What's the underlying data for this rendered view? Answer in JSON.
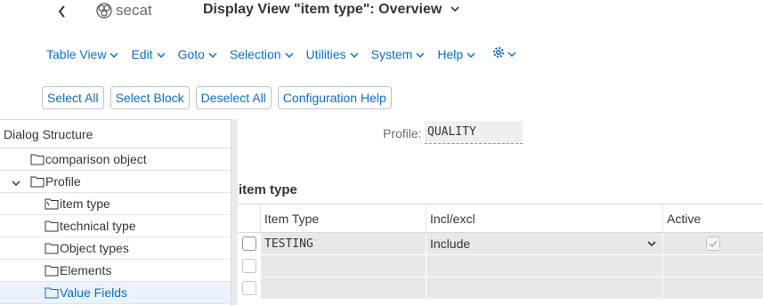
{
  "header": {
    "logo_text": "secat",
    "title": "Display View \"item type\": Overview"
  },
  "menu": [
    {
      "label": "Table View"
    },
    {
      "label": "Edit"
    },
    {
      "label": "Goto"
    },
    {
      "label": "Selection"
    },
    {
      "label": "Utilities"
    },
    {
      "label": "System"
    },
    {
      "label": "Help"
    }
  ],
  "toolbar": {
    "select_all": "Select All",
    "select_block": "Select Block",
    "deselect_all": "Deselect All",
    "config_help": "Configuration Help"
  },
  "dialog": {
    "header": "Dialog Structure",
    "items": [
      {
        "label": "comparison object"
      },
      {
        "label": "Profile"
      },
      {
        "label": "item type"
      },
      {
        "label": "technical type"
      },
      {
        "label": "Object types"
      },
      {
        "label": "Elements"
      },
      {
        "label": "Value Fields"
      }
    ]
  },
  "profile": {
    "label": "Profile:",
    "value": "QUALITY"
  },
  "section": {
    "title": "item type"
  },
  "table": {
    "columns": [
      "Item Type",
      "Incl/excl",
      "Active"
    ],
    "rows": [
      {
        "item_type": "TESTING",
        "incl_excl": "Include",
        "active": true
      },
      {
        "item_type": "",
        "incl_excl": "",
        "active": false
      },
      {
        "item_type": "",
        "incl_excl": "",
        "active": false
      }
    ]
  },
  "colors": {
    "accent": "#0a6ed1",
    "text": "#32363a",
    "selected_row": "#eaf3fc",
    "cell_bg": "#e8e8e8"
  }
}
